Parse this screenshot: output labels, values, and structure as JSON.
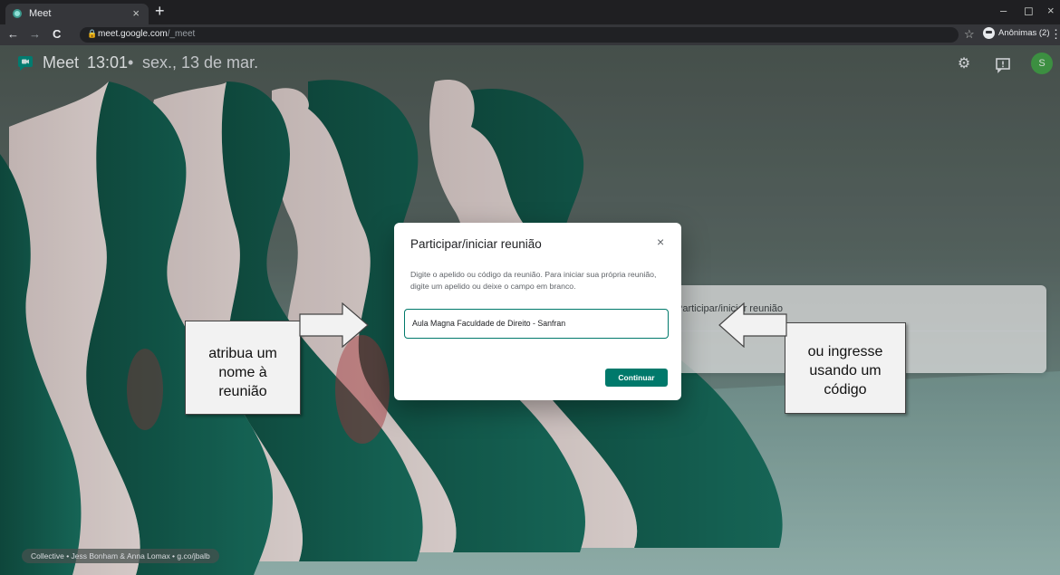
{
  "browser": {
    "tab_title": "Meet",
    "tab_close": "×",
    "new_tab": "+",
    "url_host": "meet.google.com",
    "url_path": "/_meet",
    "incognito_label": "Anônimas (2)",
    "window_controls": [
      "–",
      "◻",
      "×"
    ],
    "nav": {
      "back": "←",
      "forward": "→",
      "reload": "C"
    }
  },
  "meet": {
    "app_name": "Meet",
    "time": "13:01",
    "separator": "•",
    "date": "sex., 13 de mar.",
    "icons": [
      "gear-icon",
      "feedback-icon",
      "account-avatar"
    ],
    "avatar_initial": "S",
    "credit": "Collective • Jess Bonham & Anna Lomax • g.co/jbalb",
    "background_card_text": "Participar/iniciar reunião"
  },
  "dialog": {
    "title": "Participar/iniciar reunião",
    "close_label": "×",
    "description": "Digite o apelido ou código da reunião. Para iniciar sua própria reunião, digite um apelido ou deixe o campo em branco.",
    "input_value": "Aula Magna Faculdade de Direito - Sanfran",
    "continue_label": "Continuar"
  },
  "callouts": {
    "left": [
      "atribua um",
      "nome à",
      "reunião"
    ],
    "right": [
      "ou ingresse",
      "usando um",
      "código"
    ]
  },
  "colors": {
    "accent": "#00796b",
    "chrome_dark": "#35363a",
    "avatar": "#43a047"
  }
}
